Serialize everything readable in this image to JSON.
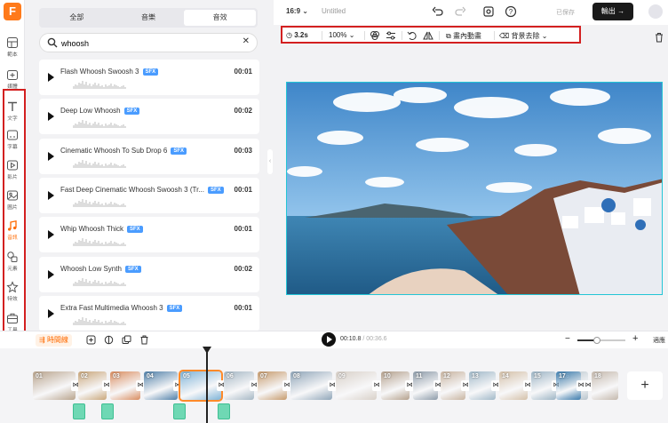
{
  "brand": {
    "logo_letter": "F",
    "accent": "#ff6a00"
  },
  "rail": [
    {
      "label": "範本",
      "icon": "template-icon"
    },
    {
      "label": "媒體",
      "icon": "upload-icon"
    },
    {
      "label": "文字",
      "icon": "text-icon"
    },
    {
      "label": "字幕",
      "icon": "subtitle-icon"
    },
    {
      "label": "影片",
      "icon": "video-icon"
    },
    {
      "label": "圖片",
      "icon": "image-icon"
    },
    {
      "label": "音訊",
      "icon": "music-icon",
      "active": true
    },
    {
      "label": "元素",
      "icon": "elements-icon"
    },
    {
      "label": "特效",
      "icon": "effects-icon"
    },
    {
      "label": "工具",
      "icon": "toolbox-icon"
    }
  ],
  "library": {
    "tabs": [
      "全部",
      "音樂",
      "音效"
    ],
    "selected_tab": "音效",
    "search_value": "whoosh",
    "sfx_badge": "SFX",
    "sounds": [
      {
        "name": "Flash Whoosh Swoosh 3",
        "duration": "00:01"
      },
      {
        "name": "Deep Low Whoosh",
        "duration": "00:02"
      },
      {
        "name": "Cinematic Whoosh To Sub Drop 6",
        "duration": "00:03"
      },
      {
        "name": "Fast Deep Cinematic Whoosh Swoosh 3 (Tr...",
        "duration": "00:01"
      },
      {
        "name": "Whip Whoosh Thick",
        "duration": "00:01"
      },
      {
        "name": "Whoosh Low Synth",
        "duration": "00:02"
      },
      {
        "name": "Extra Fast Multimedia Whoosh 3",
        "duration": "00:01"
      }
    ]
  },
  "topbar": {
    "aspect_ratio": "16:9",
    "project_title": "Untitled",
    "saved_status": "已保存",
    "export_label": "輸出"
  },
  "toolbar": {
    "duration": "3.2s",
    "zoom": "100%",
    "motion_label": "畫內動畫",
    "bg_remove_label": "背景去除"
  },
  "timeline": {
    "scene_label": "時間線",
    "current_time": "00:10.8",
    "total_time": "/ 00:36.6",
    "fit_label": "適應",
    "zoom_level": 0.4,
    "clip_numbers": [
      "01",
      "02",
      "03",
      "04",
      "05",
      "06",
      "07",
      "08",
      "09",
      "10",
      "11",
      "12",
      "13",
      "14",
      "15",
      "16",
      "17",
      "18"
    ],
    "selected_clip": "05"
  }
}
